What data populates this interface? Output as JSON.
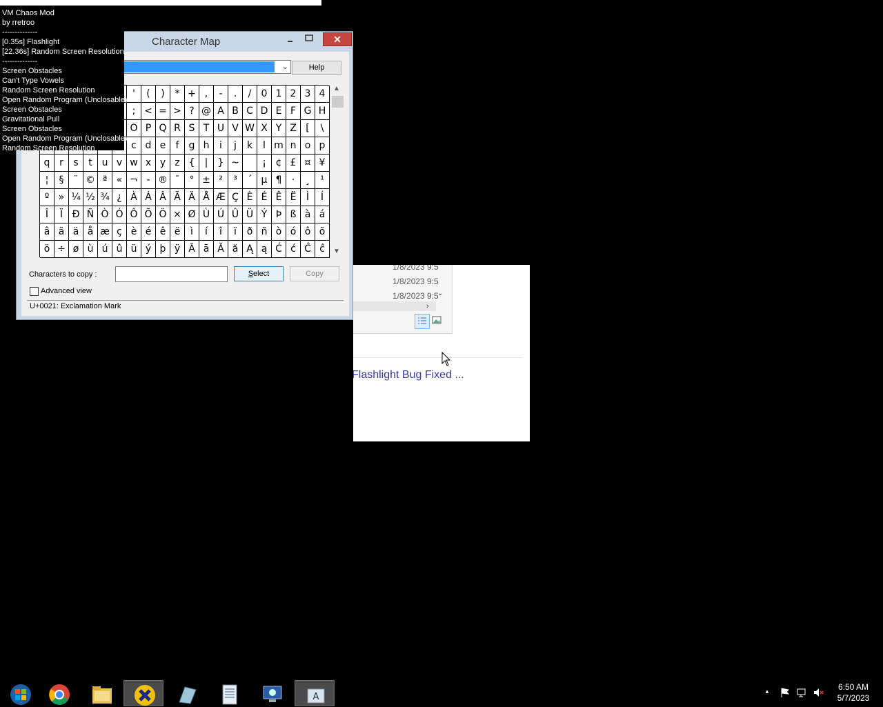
{
  "overlay": {
    "title": "VM Chaos Mod",
    "author": "by rretroo",
    "divider1": "--------------",
    "active": [
      "[0.35s] Flashlight",
      "[22.36s] Random Screen Resolution"
    ],
    "divider2": "--------------",
    "history": [
      "Screen Obstacles",
      "Can't Type Vowels",
      "Random Screen Resolution",
      "Open Random Program (Unclosable)",
      "Screen Obstacles",
      "Gravitational Pull",
      "Screen Obstacles",
      "Open Random Program (Unclosable)",
      "Random Screen Resolution"
    ]
  },
  "charmap": {
    "title": "Character Map",
    "help_label": "Help",
    "chars_to_copy_label": "Characters to copy :",
    "chars_to_copy_value": "",
    "select_label": "Select",
    "copy_label": "Copy",
    "advanced_view_label": "Advanced view",
    "advanced_view_checked": false,
    "status": "U+0021: Exclamation Mark",
    "grid_rows": [
      [
        "",
        "",
        "",
        "",
        "",
        "",
        "'",
        "(",
        ")",
        "*",
        "+",
        ",",
        "-",
        ".",
        "/",
        "0",
        "1",
        "2",
        "3",
        "4"
      ],
      [
        "",
        "",
        "",
        "",
        "",
        "",
        ";",
        "<",
        "=",
        ">",
        "?",
        "@",
        "A",
        "B",
        "C",
        "D",
        "E",
        "F",
        "G",
        "H"
      ],
      [
        "",
        "",
        "",
        "",
        "",
        "",
        "O",
        "P",
        "Q",
        "R",
        "S",
        "T",
        "U",
        "V",
        "W",
        "X",
        "Y",
        "Z",
        "[",
        "\\"
      ],
      [
        "",
        "",
        "",
        "",
        "",
        "",
        "c",
        "d",
        "e",
        "f",
        "g",
        "h",
        "i",
        "j",
        "k",
        "l",
        "m",
        "n",
        "o",
        "p"
      ],
      [
        "q",
        "r",
        "s",
        "t",
        "u",
        "v",
        "w",
        "x",
        "y",
        "z",
        "{",
        "|",
        "}",
        "~",
        "",
        "¡",
        "¢",
        "£",
        "¤",
        "¥"
      ],
      [
        "¦",
        "§",
        "¨",
        "©",
        "ª",
        "«",
        "¬",
        "-",
        "®",
        "¯",
        "°",
        "±",
        "²",
        "³",
        "´",
        "µ",
        "¶",
        "·",
        "¸",
        "¹"
      ],
      [
        "º",
        "»",
        "¼",
        "½",
        "¾",
        "¿",
        "À",
        "Á",
        "Â",
        "Ã",
        "Ä",
        "Å",
        "Æ",
        "Ç",
        "È",
        "É",
        "Ê",
        "Ë",
        "Ì",
        "Í"
      ],
      [
        "Î",
        "Ï",
        "Ð",
        "Ñ",
        "Ò",
        "Ó",
        "Ô",
        "Õ",
        "Ö",
        "×",
        "Ø",
        "Ù",
        "Ú",
        "Û",
        "Ü",
        "Ý",
        "Þ",
        "ß",
        "à",
        "á"
      ],
      [
        "â",
        "ã",
        "ä",
        "å",
        "æ",
        "ç",
        "è",
        "é",
        "ê",
        "ë",
        "ì",
        "í",
        "î",
        "ï",
        "ð",
        "ñ",
        "ò",
        "ó",
        "ô",
        "õ"
      ],
      [
        "ö",
        "÷",
        "ø",
        "ù",
        "ú",
        "û",
        "ü",
        "ý",
        "þ",
        "ÿ",
        "Ā",
        "ā",
        "Ă",
        "ă",
        "Ą",
        "ą",
        "Ć",
        "ć",
        "Ĉ",
        "ĉ"
      ]
    ]
  },
  "background_window": {
    "dates": [
      "1/8/2023 9:5",
      "1/8/2023 9:5",
      "1/8/2023 9:5"
    ],
    "link_text": "Flashlight Bug Fixed ..."
  },
  "taskbar": {
    "apps": [
      "start-orb-icon",
      "chrome-icon",
      "file-explorer-icon",
      "chaos-mod-icon",
      "paint-icon",
      "notepad-icon",
      "control-panel-icon",
      "charmap-icon"
    ],
    "active_app": "chaos-mod-icon",
    "time": "6:50 AM",
    "date": "5/7/2023"
  }
}
